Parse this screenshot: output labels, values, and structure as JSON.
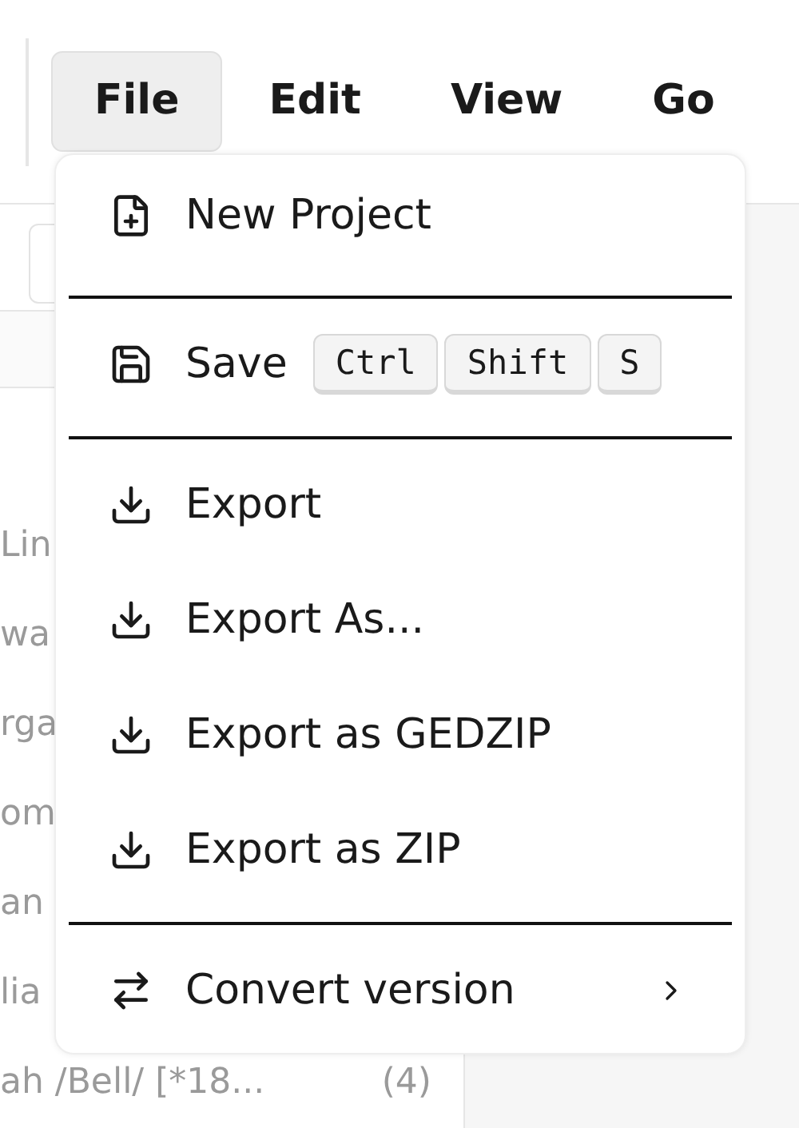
{
  "menubar": [
    {
      "label": "File",
      "selected": true
    },
    {
      "label": "Edit",
      "selected": false
    },
    {
      "label": "View",
      "selected": false
    },
    {
      "label": "Go",
      "selected": false
    }
  ],
  "list": {
    "rows": [
      {
        "label": "Lin"
      },
      {
        "label": "wa"
      },
      {
        "label": "rga"
      },
      {
        "label": "om"
      },
      {
        "label": "an"
      },
      {
        "label": "lia"
      },
      {
        "label": "ah /Bell/ [*18...",
        "count": "(4)"
      }
    ]
  },
  "menu": {
    "items": [
      {
        "kind": "new",
        "label": "New Project"
      },
      {
        "kind": "separator"
      },
      {
        "kind": "save",
        "label": "Save",
        "keys": [
          "Ctrl",
          "Shift",
          "S"
        ]
      },
      {
        "kind": "separator"
      },
      {
        "kind": "export",
        "label": "Export"
      },
      {
        "kind": "export",
        "label": "Export As..."
      },
      {
        "kind": "export",
        "label": "Export as GEDZIP"
      },
      {
        "kind": "export",
        "label": "Export as ZIP"
      },
      {
        "kind": "separator"
      },
      {
        "kind": "convert",
        "label": "Convert version"
      }
    ]
  }
}
